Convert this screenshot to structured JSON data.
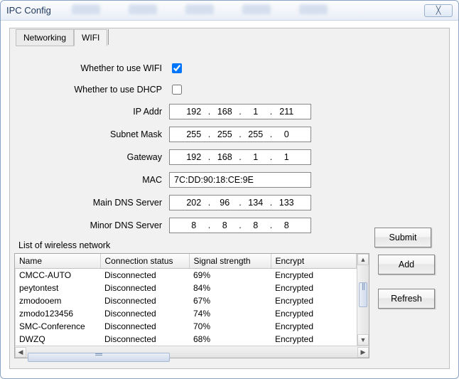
{
  "window": {
    "title": "IPC Config"
  },
  "tabs": {
    "networking": "Networking",
    "wifi": "WIFI"
  },
  "form": {
    "use_wifi_label": "Whether to use WIFI",
    "use_dhcp_label": "Whether to use DHCP",
    "ip_label": "IP Addr",
    "subnet_label": "Subnet Mask",
    "gateway_label": "Gateway",
    "mac_label": "MAC",
    "main_dns_label": "Main DNS Server",
    "minor_dns_label": "Minor DNS Server",
    "ip": [
      "192",
      "168",
      "1",
      "211"
    ],
    "subnet": [
      "255",
      "255",
      "255",
      "0"
    ],
    "gateway": [
      "192",
      "168",
      "1",
      "1"
    ],
    "mac": "7C:DD:90:18:CE:9E",
    "main_dns": [
      "202",
      "96",
      "134",
      "133"
    ],
    "minor_dns": [
      "8",
      "8",
      "8",
      "8"
    ],
    "use_wifi_checked": true,
    "use_dhcp_checked": false
  },
  "buttons": {
    "submit": "Submit",
    "add": "Add",
    "refresh": "Refresh"
  },
  "list": {
    "title": "List of wireless network",
    "headers": {
      "name": "Name",
      "status": "Connection status",
      "signal": "Signal strength",
      "encrypt": "Encrypt"
    },
    "rows": [
      {
        "name": "CMCC-AUTO",
        "status": "Disconnected",
        "signal": "69%",
        "encrypt": "Encrypted"
      },
      {
        "name": "peytontest",
        "status": "Disconnected",
        "signal": "84%",
        "encrypt": "Encrypted"
      },
      {
        "name": "zmodooem",
        "status": "Disconnected",
        "signal": "67%",
        "encrypt": "Encrypted"
      },
      {
        "name": "zmodo123456",
        "status": "Disconnected",
        "signal": "74%",
        "encrypt": "Encrypted"
      },
      {
        "name": "SMC-Conference",
        "status": "Disconnected",
        "signal": "70%",
        "encrypt": "Encrypted"
      },
      {
        "name": "DWZQ",
        "status": "Disconnected",
        "signal": "68%",
        "encrypt": "Encrypted"
      }
    ]
  }
}
